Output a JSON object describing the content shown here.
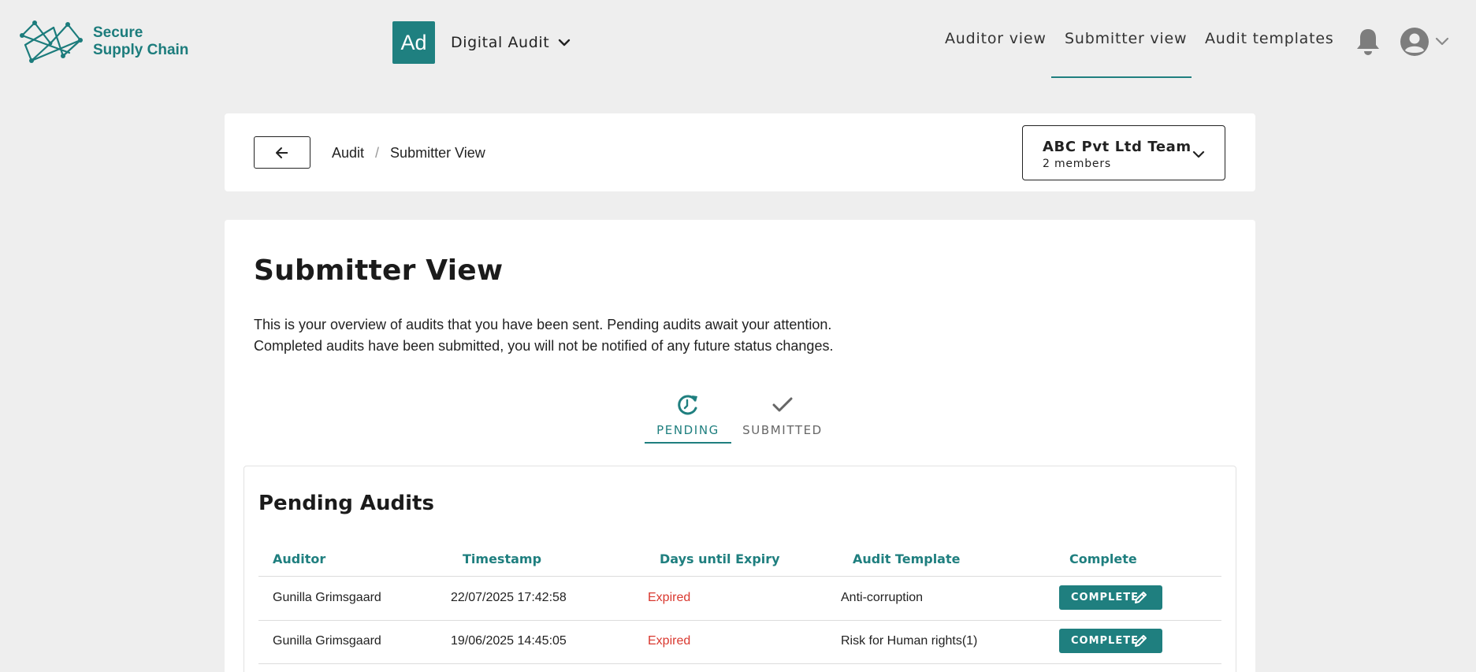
{
  "brand": {
    "line1": "Secure",
    "line2": "Supply Chain",
    "color": "#1c7c7c"
  },
  "app": {
    "badge": "Ad",
    "name": "Digital Audit"
  },
  "nav": {
    "items": [
      {
        "label": "Auditor view",
        "active": false
      },
      {
        "label": "Submitter view",
        "active": true
      },
      {
        "label": "Audit templates",
        "active": false
      }
    ]
  },
  "icons": {
    "bell": "bell-icon",
    "avatar": "user-avatar-icon",
    "back": "arrow-left-icon",
    "pending": "refresh-clock-icon",
    "submitted": "check-icon",
    "edit": "pencil-icon"
  },
  "breadcrumb": {
    "items": [
      "Audit",
      "Submitter View"
    ],
    "separator": "/"
  },
  "team": {
    "name": "ABC Pvt Ltd Team",
    "members": "2 members"
  },
  "page": {
    "title": "Submitter View",
    "description_line1": "This is your overview of audits that you have been sent. Pending audits await your attention.",
    "description_line2": "Completed audits have been submitted, you will not be notified of any future status changes."
  },
  "tabs": {
    "pending": "PENDING",
    "submitted": "SUBMITTED",
    "active": "pending"
  },
  "table": {
    "title": "Pending Audits",
    "headers": [
      "Auditor",
      "Timestamp",
      "Days until Expiry",
      "Audit Template",
      "Complete"
    ],
    "rows": [
      {
        "auditor": "Gunilla Grimsgaard",
        "timestamp": "22/07/2025 17:42:58",
        "expiry": "Expired",
        "template": "Anti-corruption",
        "action": "COMPLETE"
      },
      {
        "auditor": "Gunilla Grimsgaard",
        "timestamp": "19/06/2025 14:45:05",
        "expiry": "Expired",
        "template": "Risk for Human rights(1)",
        "action": "COMPLETE"
      }
    ]
  },
  "colors": {
    "accent": "#1f7f7f",
    "expired": "#d9382f",
    "background": "#eeeeee"
  }
}
